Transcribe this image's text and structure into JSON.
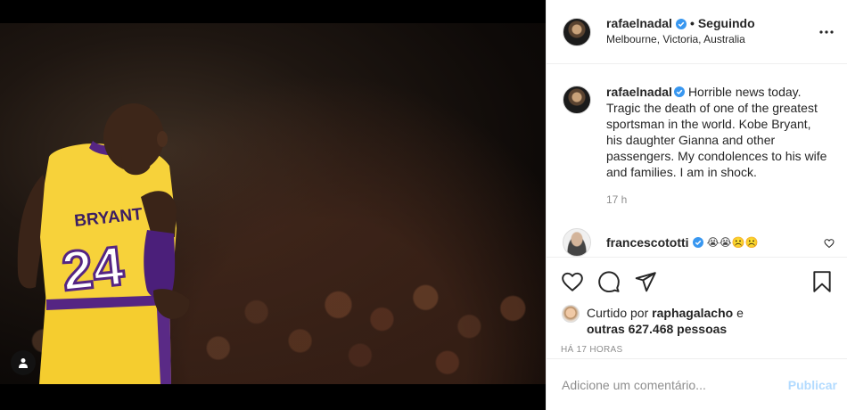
{
  "post": {
    "author": "rafaelnadal",
    "follow_status": "Seguindo",
    "separator": "•",
    "location": "Melbourne, Victoria, Australia",
    "caption": "Horrible news today. Tragic the death of one of the greatest sportsman in the world. Kobe Bryant, his daughter Gianna and other passengers. My condolences to his wife and families. I am in shock.",
    "time_short": "17 h",
    "time_long": "HÁ 17 HORAS"
  },
  "image": {
    "jersey_name": "BRYANT",
    "jersey_number": "24"
  },
  "comment": {
    "username": "francescototti",
    "text": "😭😭☹️☹️"
  },
  "likes": {
    "prefix": "Curtido por",
    "first_user": "raphagalacho",
    "middle": "e",
    "others": "outras 627.468 pessoas"
  },
  "add_comment": {
    "placeholder": "Adicione um comentário...",
    "publish_label": "Publicar"
  },
  "colors": {
    "verified": "#3897f0",
    "publish_disabled": "#b3dbff",
    "jersey_yellow": "#f7d23a",
    "jersey_purple": "#552583"
  }
}
